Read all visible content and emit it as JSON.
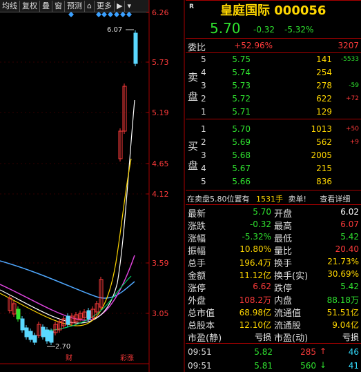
{
  "toolbar": {
    "items": [
      "均线",
      "复权",
      "叠",
      "窗",
      "预测",
      "更多"
    ]
  },
  "price_axis": [
    "6.26",
    "5.73",
    "5.19",
    "4.65",
    "4.12",
    "3.59",
    "3.05"
  ],
  "chart_annotations": {
    "high": "6.07",
    "low": "2.70",
    "tag1": "财",
    "tag2": "彩涨"
  },
  "header": {
    "market": "R",
    "name": "皇庭国际 000056",
    "price": "5.70",
    "change": "-0.32",
    "change_pct": "-5.32%"
  },
  "weibi": {
    "label": "委比",
    "pct": "+52.96%",
    "diff": "3207"
  },
  "sell_label": [
    "卖",
    "盘"
  ],
  "buy_label": [
    "买",
    "盘"
  ],
  "sell": [
    {
      "lvl": "5",
      "price": "5.75",
      "vol": "141",
      "chg": "-5533"
    },
    {
      "lvl": "4",
      "price": "5.74",
      "vol": "254",
      "chg": ""
    },
    {
      "lvl": "3",
      "price": "5.73",
      "vol": "278",
      "chg": "-59"
    },
    {
      "lvl": "2",
      "price": "5.72",
      "vol": "622",
      "chg": "+72"
    },
    {
      "lvl": "1",
      "price": "5.71",
      "vol": "129",
      "chg": ""
    }
  ],
  "buy": [
    {
      "lvl": "1",
      "price": "5.70",
      "vol": "1013",
      "chg": "+50"
    },
    {
      "lvl": "2",
      "price": "5.69",
      "vol": "562",
      "chg": "+9"
    },
    {
      "lvl": "3",
      "price": "5.68",
      "vol": "2005",
      "chg": ""
    },
    {
      "lvl": "4",
      "price": "5.67",
      "vol": "215",
      "chg": ""
    },
    {
      "lvl": "5",
      "price": "5.66",
      "vol": "836",
      "chg": ""
    }
  ],
  "notice": {
    "text": "在卖盘5.80位置有",
    "qty": "1531手",
    "tail": "卖单!",
    "link": "查看详细"
  },
  "stats_left": [
    {
      "label": "最新",
      "value": "5.70",
      "color": "green"
    },
    {
      "label": "涨跌",
      "value": "-0.32",
      "color": "green"
    },
    {
      "label": "涨幅",
      "value": "-5.32%",
      "color": "green"
    },
    {
      "label": "振幅",
      "value": "10.80%",
      "color": "yellow"
    },
    {
      "label": "总手",
      "value": "196.4万",
      "color": "yellow"
    },
    {
      "label": "金额",
      "value": "11.12亿",
      "color": "yellow"
    },
    {
      "label": "涨停",
      "value": "6.62",
      "color": "red"
    },
    {
      "label": "外盘",
      "value": "108.2万",
      "color": "red"
    },
    {
      "label": "总市值",
      "value": "68.98亿",
      "color": "yellow"
    },
    {
      "label": "总股本",
      "value": "12.10亿",
      "color": "yellow"
    },
    {
      "label": "市盈(静)",
      "value": "亏损",
      "color": "white"
    }
  ],
  "stats_right": [
    {
      "label": "开盘",
      "value": "6.02",
      "color": "white"
    },
    {
      "label": "最高",
      "value": "6.07",
      "color": "red"
    },
    {
      "label": "最低",
      "value": "5.42",
      "color": "green"
    },
    {
      "label": "量比",
      "value": "20.40",
      "color": "red"
    },
    {
      "label": "换手",
      "value": "21.73%",
      "color": "yellow"
    },
    {
      "label": "换手(实)",
      "value": "30.69%",
      "color": "yellow"
    },
    {
      "label": "跌停",
      "value": "5.42",
      "color": "green"
    },
    {
      "label": "内盘",
      "value": "88.18万",
      "color": "green"
    },
    {
      "label": "流通值",
      "value": "51.51亿",
      "color": "yellow"
    },
    {
      "label": "流通股",
      "value": "9.04亿",
      "color": "yellow"
    },
    {
      "label": "市盈(动)",
      "value": "亏损",
      "color": "white"
    }
  ],
  "ticks": [
    {
      "time": "09:51",
      "price": "5.82",
      "vol": "285",
      "dir": "↑",
      "n": "46"
    },
    {
      "time": "09:51",
      "price": "5.81",
      "vol": "560",
      "dir": "↓",
      "n": "41"
    }
  ]
}
